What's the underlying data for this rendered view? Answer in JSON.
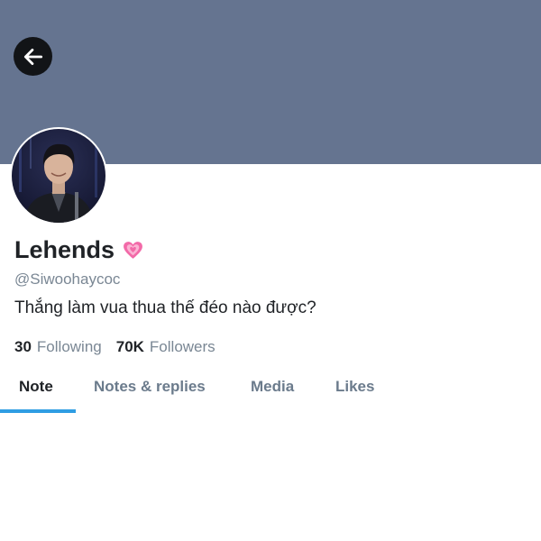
{
  "profile": {
    "display_name": "Lehends",
    "handle": "@Siwoohaycoc",
    "bio": "Thắng làm vua thua thế đéo nào được?",
    "avatar_icon": "avatar-icon",
    "name_emoji": "growing-heart-icon"
  },
  "stats": {
    "following_count": "30",
    "following_label": "Following",
    "followers_count": "70K",
    "followers_label": "Followers"
  },
  "tabs": [
    {
      "label": "Note",
      "active": true
    },
    {
      "label": "Notes & replies",
      "active": false
    },
    {
      "label": "Media",
      "active": false
    },
    {
      "label": "Likes",
      "active": false
    }
  ],
  "colors": {
    "banner": "#657490",
    "accent": "#2f9de3",
    "muted_text": "#7a8794",
    "back_button": "#121417"
  }
}
